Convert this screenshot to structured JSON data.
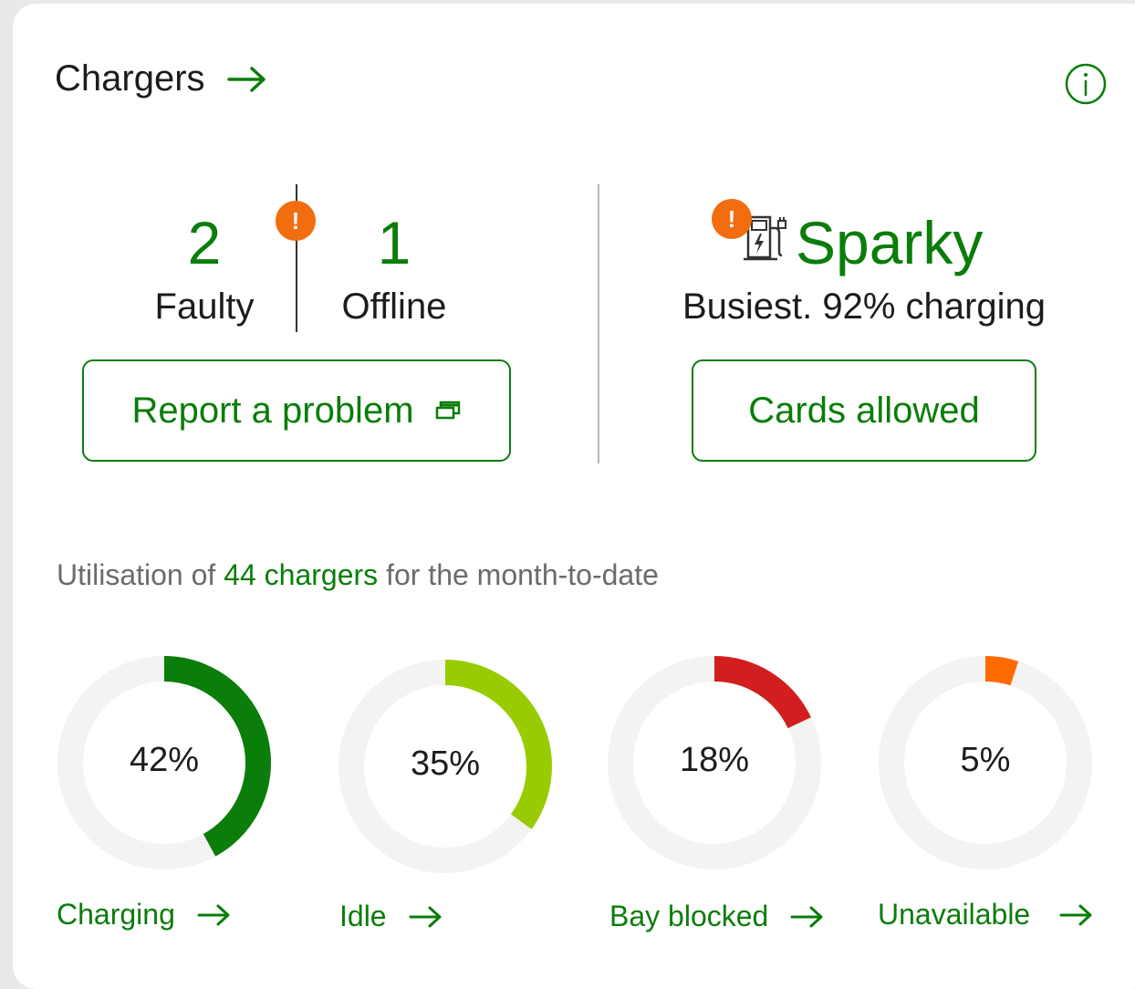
{
  "header": {
    "title": "Chargers"
  },
  "faulty": {
    "count": "2",
    "label": "Faulty",
    "badge": "!"
  },
  "offline": {
    "count": "1",
    "label": "Offline"
  },
  "report_button": {
    "label": "Report a problem"
  },
  "busiest": {
    "badge": "!",
    "name": "Sparky",
    "subtitle": "Busiest. 92% charging"
  },
  "cards_button": {
    "label": "Cards allowed"
  },
  "utilisation": {
    "prefix": "Utilisation of ",
    "link": "44 chargers",
    "suffix": " for the month-to-date"
  },
  "chart_data": {
    "type": "donut",
    "series": [
      {
        "name": "Charging",
        "value": 42,
        "label": "42%",
        "color": "#0a7d0a"
      },
      {
        "name": "Idle",
        "value": 35,
        "label": "35%",
        "color": "#99cc00"
      },
      {
        "name": "Bay blocked",
        "value": 18,
        "label": "18%",
        "color": "#d11f1f"
      },
      {
        "name": "Unavailable",
        "value": 5,
        "label": "5%",
        "color": "#ff6a00"
      }
    ],
    "track_color": "#f3f3f3"
  },
  "icons": {
    "arrow": "arrow-right-icon",
    "info": "info-icon",
    "external": "external-window-icon",
    "charger": "ev-charger-icon"
  }
}
